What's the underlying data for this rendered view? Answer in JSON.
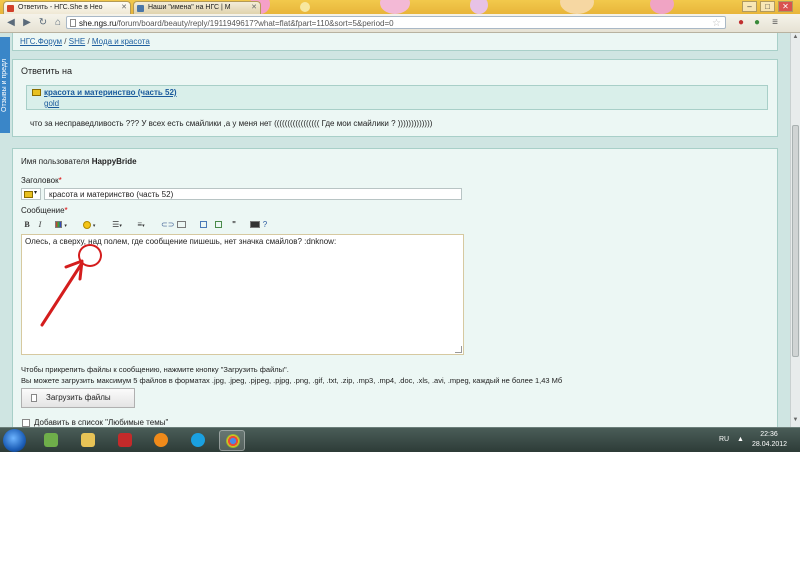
{
  "browser": {
    "tabs": [
      {
        "label": "Ответить - НГС.She в Нео",
        "active": true,
        "icon": "ngs-favicon"
      },
      {
        "label": "Наши \"имена\" на НГС | М",
        "active": false,
        "icon": "vk-favicon"
      }
    ],
    "url_host": "she.ngs.ru",
    "url_path": "/forum/board/beauty/reply/1911949617?what=flat&fpart=110&sort=5&period=0",
    "window_controls": [
      "–",
      "□",
      "✕"
    ]
  },
  "page": {
    "side_tab": "Отзывы и предл",
    "breadcrumbs": [
      "НГС.Форум",
      "SHE",
      "Мода и красота"
    ],
    "breadcrumb_sep": "/",
    "reply_heading": "Ответить на",
    "quoted": {
      "topic": "красота и материнство (часть 52)",
      "author": "gold",
      "text": "что за несправедливость ??? У всех есть смайлики ,а у меня нет ((((((((((((((((( Где мои смайлики ? )))))))))))))"
    },
    "form": {
      "username_label": "Имя пользователя",
      "username": "HappyBride",
      "title_label": "Заголовок",
      "title_value": "красота и материнство (часть 52)",
      "message_label": "Сообщение",
      "required_mark": "*",
      "message_text": "Олесь, а сверху, над полем, где сообщение пишешь, нет значка смайлов?  :dnknow:",
      "toolbar": {
        "bold": "B",
        "italic": "I",
        "quote": "\"",
        "help": "?"
      },
      "attach_info_1": "Чтобы прикрепить файлы к сообщению, нажмите кнопку \"Загрузить файлы\".",
      "attach_info_2": "Вы можете загрузить максимум 5 файлов в форматах .jpg, .jpeg, .pjpeg, .pjpg, .png, .gif, .txt, .zip, .mp3, .mp4, .doc, .xls, .avi, .mpeg, каждый не более 1,43 Мб",
      "upload_button": "Загрузить файлы",
      "favorites_label": "Добавить в список \"Любимые темы\""
    }
  },
  "taskbar": {
    "lang": "RU",
    "time": "22:36",
    "date": "28.04.2012",
    "apps": [
      "explorer-icon",
      "media-icon",
      "folder-icon",
      "pdf-icon",
      "orange-icon",
      "skype-icon",
      "chrome-icon"
    ]
  },
  "colors": {
    "page_bg": "#cfe5e2",
    "panel_bg": "#ecf7f4",
    "link": "#1f5fa0",
    "annotation": "#d41d1d",
    "tabstrip": "#e8b53a"
  }
}
